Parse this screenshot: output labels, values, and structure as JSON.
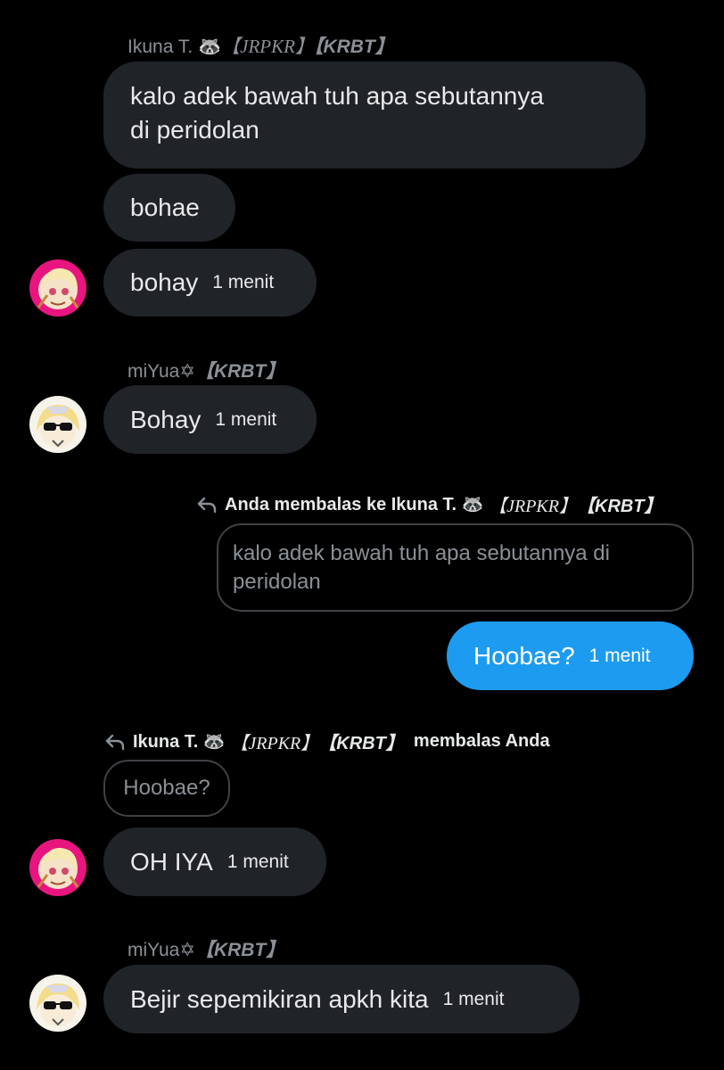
{
  "messages": [
    {
      "sender": {
        "name": "Ikuna T. 🦝",
        "tag1": "【JRPKR】",
        "tag2": "【KRBT】"
      },
      "bubbles": [
        {
          "line1": "kalo adek bawah tuh apa sebutannya",
          "line2": "di peridolan"
        },
        {
          "text": "bohae"
        },
        {
          "text": "bohay",
          "time": "1 menit"
        }
      ]
    },
    {
      "sender": {
        "name": "miYua✡",
        "tag": "【KRBT】"
      },
      "bubbles": [
        {
          "text": "Bohay",
          "time": "1 menit"
        }
      ]
    },
    {
      "reply": {
        "prefix": "Anda membalas ke Ikuna T. 🦝",
        "tag1": "【JRPKR】",
        "tag2": "【KRBT】"
      },
      "quote": {
        "line1": "kalo adek bawah tuh apa sebutannya di",
        "line2": "peridolan"
      },
      "bubble": {
        "text": "Hoobae?",
        "time": "1 menit"
      }
    },
    {
      "reply": {
        "prefix": "Ikuna T. 🦝",
        "tag1": "【JRPKR】",
        "tag2": "【KRBT】",
        "suffix": "membalas Anda"
      },
      "quote": {
        "text": "Hoobae?"
      },
      "bubble": {
        "text": "OH IYA",
        "time": "1 menit"
      }
    },
    {
      "sender": {
        "name": "miYua✡",
        "tag": "【KRBT】"
      },
      "bubble": {
        "text": "Bejir sepemikiran apkh kita",
        "time": "1 menit"
      }
    }
  ],
  "icons": {
    "reply": "reply-arrow-icon",
    "avatar_ikuna": "avatar-pink-anime",
    "avatar_miyua": "avatar-sunglasses-anime"
  },
  "colors": {
    "background": "#000000",
    "bubble_incoming": "#202327",
    "bubble_outgoing": "#1d9bf0",
    "muted_text": "#8b9096",
    "quote_border": "#3e4145"
  }
}
